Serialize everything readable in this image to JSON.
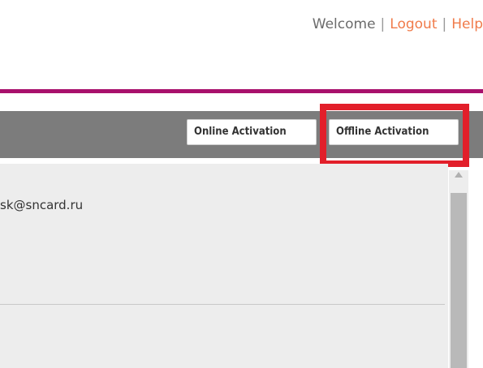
{
  "header": {
    "welcome": "Welcome",
    "separator": "|",
    "logout": "Logout",
    "help": "Help"
  },
  "toolbar": {
    "online_activation": "Online Activation",
    "offline_activation": "Offline Activation"
  },
  "panel": {
    "email": "sk@sncard.ru"
  },
  "colors": {
    "accent_bar": "#a8106c",
    "link": "#f07b4a",
    "toolbar_bg": "#7c7c7c",
    "highlight": "#e21f2a"
  }
}
